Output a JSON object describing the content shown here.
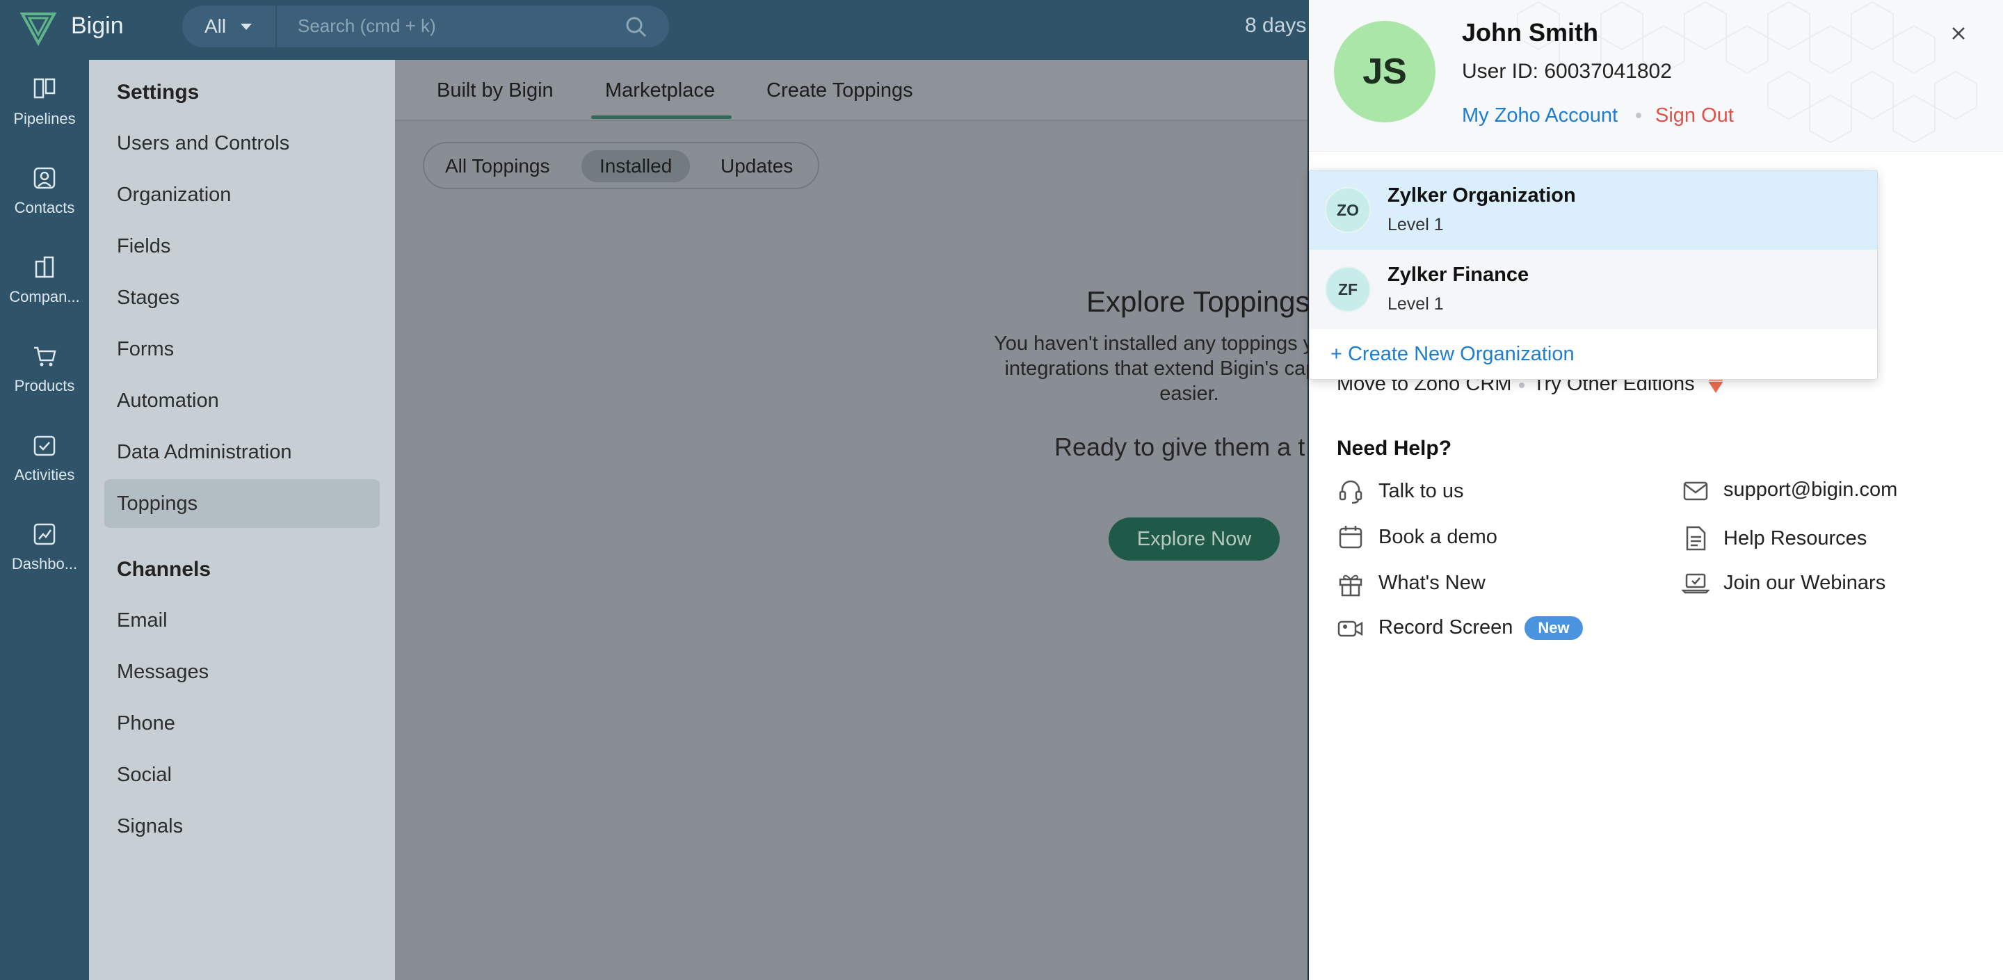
{
  "app": {
    "brand": "Bigin",
    "trial_text": "8 days"
  },
  "search": {
    "module": "All",
    "placeholder": "Search (cmd + k)"
  },
  "nav": [
    {
      "label": "Pipelines",
      "icon": "pipelines-icon"
    },
    {
      "label": "Contacts",
      "icon": "contacts-icon"
    },
    {
      "label": "Compan...",
      "icon": "companies-icon"
    },
    {
      "label": "Products",
      "icon": "products-icon"
    },
    {
      "label": "Activities",
      "icon": "activities-icon"
    },
    {
      "label": "Dashbo...",
      "icon": "dashboards-icon"
    }
  ],
  "settings": {
    "heading": "Settings",
    "items": [
      "Users and Controls",
      "Organization",
      "Fields",
      "Stages",
      "Forms",
      "Automation",
      "Data Administration",
      "Toppings"
    ],
    "active": "Toppings",
    "channels_heading": "Channels",
    "channels": [
      "Email",
      "Messages",
      "Phone",
      "Social",
      "Signals"
    ]
  },
  "tabs": [
    "Built by Bigin",
    "Marketplace",
    "Create Toppings"
  ],
  "active_tab": "Marketplace",
  "pills": [
    "All Toppings",
    "Installed",
    "Updates"
  ],
  "active_pill": "Installed",
  "empty_state": {
    "title": "Explore Toppings",
    "line1": "You haven't installed any toppings yet. Topp",
    "line2": "integrations that extend Bigin's capabilitie",
    "line3": "easier.",
    "subtitle": "Ready to give them a t",
    "button": "Explore Now"
  },
  "profile": {
    "initials": "JS",
    "name": "John Smith",
    "user_id": "User ID: 60037041802",
    "my_account": "My Zoho Account",
    "sign_out": "Sign Out",
    "move_crm": "Move to Zoho CRM",
    "try_editions": "Try Other Editions",
    "help_title": "Need Help?",
    "help_left": [
      {
        "label": "Talk to us",
        "icon": "headset-icon"
      },
      {
        "label": "Book a demo",
        "icon": "calendar-icon"
      },
      {
        "label": "What's New",
        "icon": "gift-icon"
      },
      {
        "label": "Record Screen",
        "icon": "video-camera-icon"
      }
    ],
    "help_right": [
      {
        "label": "support@bigin.com",
        "icon": "mail-icon"
      },
      {
        "label": "Help Resources",
        "icon": "document-icon"
      },
      {
        "label": "Join our Webinars",
        "icon": "laptop-icon"
      }
    ],
    "new_badge": "New"
  },
  "org_menu": {
    "orgs": [
      {
        "initials": "ZO",
        "name": "Zylker Organization",
        "level": "Level 1"
      },
      {
        "initials": "ZF",
        "name": "Zylker Finance",
        "level": "Level 1"
      }
    ],
    "create_label": "+ Create New Organization"
  },
  "colors": {
    "nav_bg": "#2f5369",
    "overlay_panel": "#888e93",
    "accent_blue": "#1f7dd0",
    "sign_out_red": "#e0504a",
    "avatar_green": "#abe6a9",
    "selected_row": "#daeefb",
    "new_badge": "#4a94df"
  }
}
